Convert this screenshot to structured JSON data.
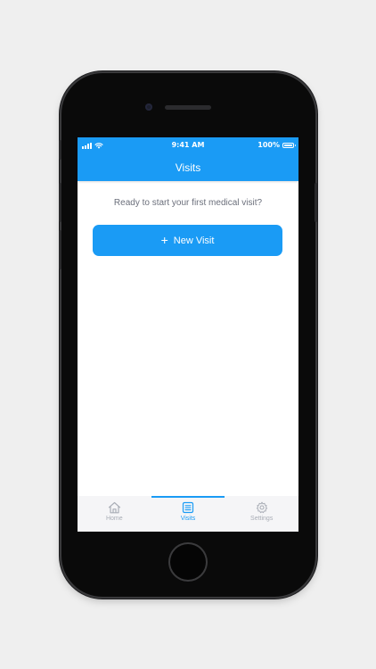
{
  "status_bar": {
    "time": "9:41 AM",
    "battery": "100%",
    "icons": [
      "signal-icon",
      "wifi-icon",
      "battery-icon"
    ]
  },
  "nav": {
    "title": "Visits"
  },
  "main": {
    "prompt": "Ready to start your first medical visit?",
    "new_visit_label": "New Visit",
    "new_visit_icon": "plus-icon"
  },
  "tabs": [
    {
      "label": "Home",
      "icon": "home-icon",
      "active": false
    },
    {
      "label": "Visits",
      "icon": "list-icon",
      "active": true
    },
    {
      "label": "Settings",
      "icon": "gear-icon",
      "active": false
    }
  ],
  "colors": {
    "accent": "#1a9bf5",
    "background": "#efefef",
    "tab_inactive": "#a9adb6",
    "prompt_text": "#6b6f7b"
  }
}
